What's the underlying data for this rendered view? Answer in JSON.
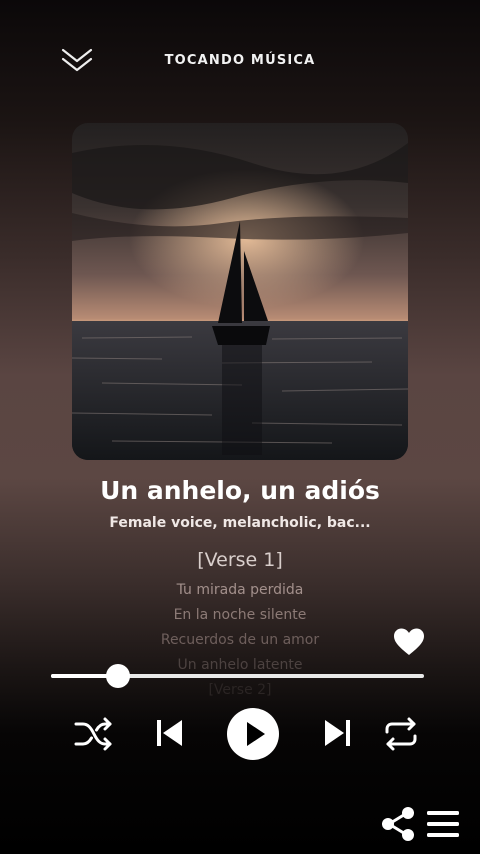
{
  "header": {
    "title": "TOCANDO MÚSICA",
    "collapse_icon": "chevron-down-double-icon"
  },
  "track": {
    "title": "Un anhelo, un adiós",
    "subtitle": "Female voice, melancholic, bac..."
  },
  "lyrics": [
    "[Verse 1]",
    "Tu mirada perdida",
    "En la noche silente",
    "Recuerdos de un amor",
    "Un anhelo latente",
    "[Verse 2]"
  ],
  "playback": {
    "progress": 0.18
  },
  "controls": {
    "shuffle_icon": "shuffle-icon",
    "previous_icon": "skip-previous-icon",
    "play_icon": "play-icon",
    "next_icon": "skip-next-icon",
    "repeat_icon": "repeat-icon",
    "favorite_icon": "heart-icon",
    "share_icon": "share-icon",
    "menu_icon": "menu-icon"
  },
  "colors": {
    "accent": "#ffffff",
    "background_dark": "#000000",
    "background_warm": "#5a4542"
  }
}
